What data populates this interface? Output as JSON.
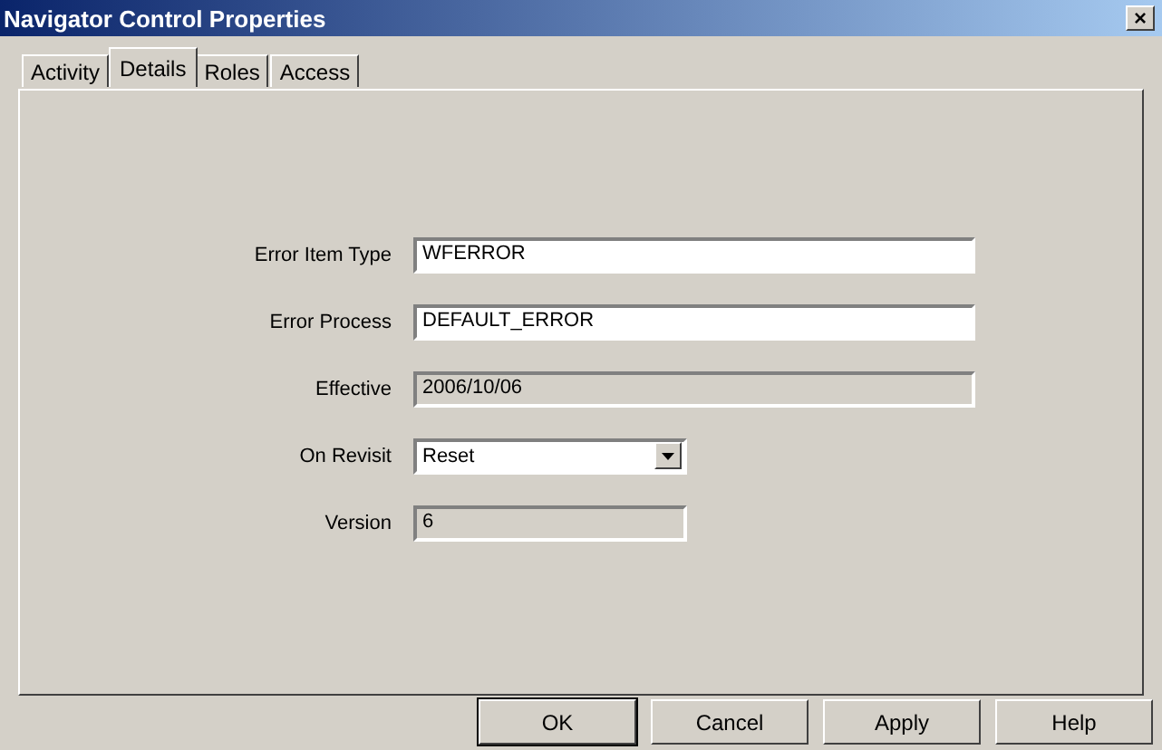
{
  "window": {
    "title": "Navigator Control Properties",
    "close": "×"
  },
  "tabs": [
    {
      "label": "Activity",
      "selected": false
    },
    {
      "label": "Details",
      "selected": true
    },
    {
      "label": "Roles",
      "selected": false
    },
    {
      "label": "Access",
      "selected": false
    }
  ],
  "fields": [
    {
      "label": "Error Item Type",
      "value": "WFERROR",
      "kind": "text",
      "disabled": false,
      "wide": true
    },
    {
      "label": "Error Process",
      "value": "DEFAULT_ERROR",
      "kind": "text",
      "disabled": false,
      "wide": true
    },
    {
      "label": "Effective",
      "value": "2006/10/06",
      "kind": "text",
      "disabled": true,
      "wide": true
    },
    {
      "label": "On Revisit",
      "value": "Reset",
      "kind": "dropdown",
      "disabled": false,
      "wide": false
    },
    {
      "label": "Version",
      "value": "6",
      "kind": "text",
      "disabled": true,
      "wide": false
    }
  ],
  "buttons": [
    {
      "label": "OK",
      "default": true
    },
    {
      "label": "Cancel",
      "default": false
    },
    {
      "label": "Apply",
      "default": false
    },
    {
      "label": "Help",
      "default": false
    }
  ]
}
